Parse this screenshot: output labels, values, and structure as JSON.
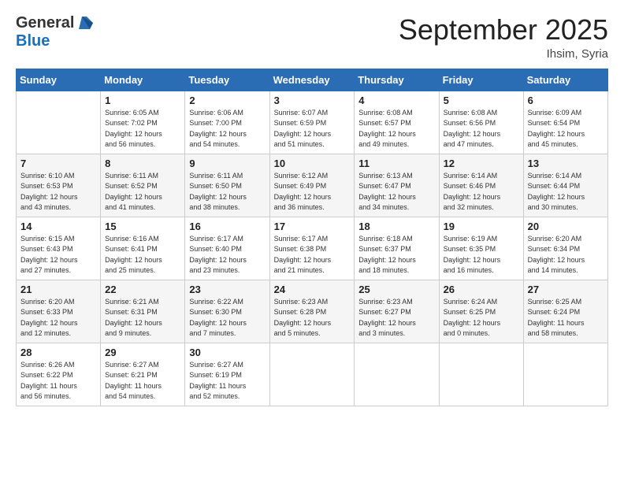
{
  "logo": {
    "general": "General",
    "blue": "Blue"
  },
  "title": "September 2025",
  "location": "Ihsim, Syria",
  "days_of_week": [
    "Sunday",
    "Monday",
    "Tuesday",
    "Wednesday",
    "Thursday",
    "Friday",
    "Saturday"
  ],
  "weeks": [
    [
      {
        "day": "",
        "info": ""
      },
      {
        "day": "1",
        "info": "Sunrise: 6:05 AM\nSunset: 7:02 PM\nDaylight: 12 hours\nand 56 minutes."
      },
      {
        "day": "2",
        "info": "Sunrise: 6:06 AM\nSunset: 7:00 PM\nDaylight: 12 hours\nand 54 minutes."
      },
      {
        "day": "3",
        "info": "Sunrise: 6:07 AM\nSunset: 6:59 PM\nDaylight: 12 hours\nand 51 minutes."
      },
      {
        "day": "4",
        "info": "Sunrise: 6:08 AM\nSunset: 6:57 PM\nDaylight: 12 hours\nand 49 minutes."
      },
      {
        "day": "5",
        "info": "Sunrise: 6:08 AM\nSunset: 6:56 PM\nDaylight: 12 hours\nand 47 minutes."
      },
      {
        "day": "6",
        "info": "Sunrise: 6:09 AM\nSunset: 6:54 PM\nDaylight: 12 hours\nand 45 minutes."
      }
    ],
    [
      {
        "day": "7",
        "info": "Sunrise: 6:10 AM\nSunset: 6:53 PM\nDaylight: 12 hours\nand 43 minutes."
      },
      {
        "day": "8",
        "info": "Sunrise: 6:11 AM\nSunset: 6:52 PM\nDaylight: 12 hours\nand 41 minutes."
      },
      {
        "day": "9",
        "info": "Sunrise: 6:11 AM\nSunset: 6:50 PM\nDaylight: 12 hours\nand 38 minutes."
      },
      {
        "day": "10",
        "info": "Sunrise: 6:12 AM\nSunset: 6:49 PM\nDaylight: 12 hours\nand 36 minutes."
      },
      {
        "day": "11",
        "info": "Sunrise: 6:13 AM\nSunset: 6:47 PM\nDaylight: 12 hours\nand 34 minutes."
      },
      {
        "day": "12",
        "info": "Sunrise: 6:14 AM\nSunset: 6:46 PM\nDaylight: 12 hours\nand 32 minutes."
      },
      {
        "day": "13",
        "info": "Sunrise: 6:14 AM\nSunset: 6:44 PM\nDaylight: 12 hours\nand 30 minutes."
      }
    ],
    [
      {
        "day": "14",
        "info": "Sunrise: 6:15 AM\nSunset: 6:43 PM\nDaylight: 12 hours\nand 27 minutes."
      },
      {
        "day": "15",
        "info": "Sunrise: 6:16 AM\nSunset: 6:41 PM\nDaylight: 12 hours\nand 25 minutes."
      },
      {
        "day": "16",
        "info": "Sunrise: 6:17 AM\nSunset: 6:40 PM\nDaylight: 12 hours\nand 23 minutes."
      },
      {
        "day": "17",
        "info": "Sunrise: 6:17 AM\nSunset: 6:38 PM\nDaylight: 12 hours\nand 21 minutes."
      },
      {
        "day": "18",
        "info": "Sunrise: 6:18 AM\nSunset: 6:37 PM\nDaylight: 12 hours\nand 18 minutes."
      },
      {
        "day": "19",
        "info": "Sunrise: 6:19 AM\nSunset: 6:35 PM\nDaylight: 12 hours\nand 16 minutes."
      },
      {
        "day": "20",
        "info": "Sunrise: 6:20 AM\nSunset: 6:34 PM\nDaylight: 12 hours\nand 14 minutes."
      }
    ],
    [
      {
        "day": "21",
        "info": "Sunrise: 6:20 AM\nSunset: 6:33 PM\nDaylight: 12 hours\nand 12 minutes."
      },
      {
        "day": "22",
        "info": "Sunrise: 6:21 AM\nSunset: 6:31 PM\nDaylight: 12 hours\nand 9 minutes."
      },
      {
        "day": "23",
        "info": "Sunrise: 6:22 AM\nSunset: 6:30 PM\nDaylight: 12 hours\nand 7 minutes."
      },
      {
        "day": "24",
        "info": "Sunrise: 6:23 AM\nSunset: 6:28 PM\nDaylight: 12 hours\nand 5 minutes."
      },
      {
        "day": "25",
        "info": "Sunrise: 6:23 AM\nSunset: 6:27 PM\nDaylight: 12 hours\nand 3 minutes."
      },
      {
        "day": "26",
        "info": "Sunrise: 6:24 AM\nSunset: 6:25 PM\nDaylight: 12 hours\nand 0 minutes."
      },
      {
        "day": "27",
        "info": "Sunrise: 6:25 AM\nSunset: 6:24 PM\nDaylight: 11 hours\nand 58 minutes."
      }
    ],
    [
      {
        "day": "28",
        "info": "Sunrise: 6:26 AM\nSunset: 6:22 PM\nDaylight: 11 hours\nand 56 minutes."
      },
      {
        "day": "29",
        "info": "Sunrise: 6:27 AM\nSunset: 6:21 PM\nDaylight: 11 hours\nand 54 minutes."
      },
      {
        "day": "30",
        "info": "Sunrise: 6:27 AM\nSunset: 6:19 PM\nDaylight: 11 hours\nand 52 minutes."
      },
      {
        "day": "",
        "info": ""
      },
      {
        "day": "",
        "info": ""
      },
      {
        "day": "",
        "info": ""
      },
      {
        "day": "",
        "info": ""
      }
    ]
  ]
}
